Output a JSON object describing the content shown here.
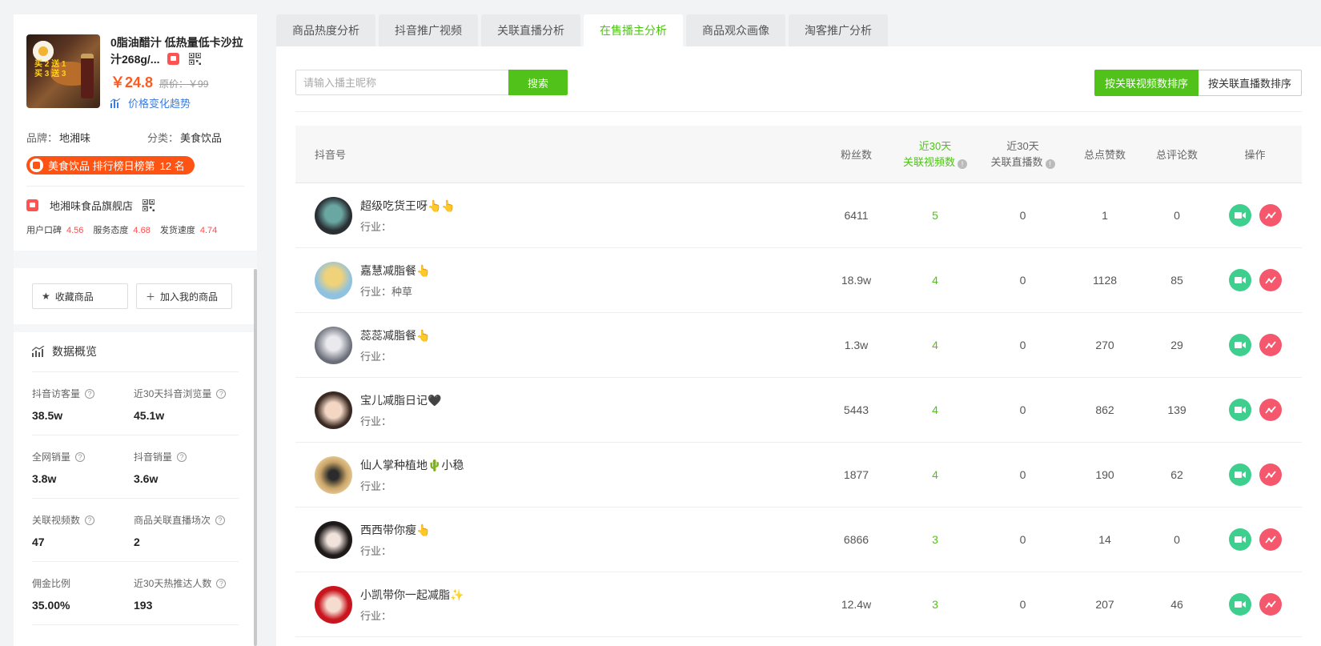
{
  "product": {
    "title": "0脂油醋汁 低热量低卡沙拉汁268g/...",
    "thumb_promo": "买 2 送 1 买 3 送 3",
    "price": "￥24.8",
    "original_price": "原价：￥99",
    "trend_link": "价格变化趋势",
    "brand_label": "品牌：",
    "brand": "地湘味",
    "category_label": "分类：",
    "category": "美食饮品",
    "rank_text": "美食饮品 排行榜日榜第",
    "rank_num": "12 名"
  },
  "shop": {
    "name": "地湘味食品旗舰店",
    "scores": [
      {
        "label": "用户口碑",
        "value": "4.56"
      },
      {
        "label": "服务态度",
        "value": "4.68"
      },
      {
        "label": "发货速度",
        "value": "4.74"
      }
    ]
  },
  "actions": {
    "favorite": "收藏商品",
    "add": "加入我的商品"
  },
  "overview": {
    "title": "数据概览",
    "rows": [
      [
        {
          "label": "抖音访客量",
          "value": "38.5w"
        },
        {
          "label": "近30天抖音浏览量",
          "value": "45.1w"
        }
      ],
      [
        {
          "label": "全网销量",
          "value": "3.8w"
        },
        {
          "label": "抖音销量",
          "value": "3.6w"
        }
      ],
      [
        {
          "label": "关联视频数",
          "value": "47"
        },
        {
          "label": "商品关联直播场次",
          "value": "2"
        }
      ],
      [
        {
          "label": "佣金比例",
          "value": "35.00%"
        },
        {
          "label": "近30天热推达人数",
          "value": "193"
        }
      ]
    ]
  },
  "tabs": [
    "商品热度分析",
    "抖音推广视频",
    "关联直播分析",
    "在售播主分析",
    "商品观众画像",
    "淘客推广分析"
  ],
  "active_tab": "在售播主分析",
  "search": {
    "placeholder": "请输入播主昵称",
    "button": "搜索"
  },
  "sort": {
    "by_video": "按关联视频数排序",
    "by_live": "按关联直播数排序"
  },
  "table": {
    "headers": {
      "account": "抖音号",
      "fans": "粉丝数",
      "videos_l1": "近30天",
      "videos_l2": "关联视频数",
      "live_l1": "近30天",
      "live_l2": "关联直播数",
      "likes": "总点赞数",
      "comments": "总评论数",
      "ops": "操作"
    },
    "industry_label": "行业：",
    "rows": [
      {
        "name": "超级吃货王呀👆👆",
        "industry": "",
        "fans": "6411",
        "videos": "5",
        "lives": "0",
        "likes": "1",
        "comments": "0"
      },
      {
        "name": "嘉慧减脂餐👆",
        "industry": "种草",
        "fans": "18.9w",
        "videos": "4",
        "lives": "0",
        "likes": "1128",
        "comments": "85"
      },
      {
        "name": "蕊蕊减脂餐👆",
        "industry": "",
        "fans": "1.3w",
        "videos": "4",
        "lives": "0",
        "likes": "270",
        "comments": "29"
      },
      {
        "name": "宝儿减脂日记🖤",
        "industry": "",
        "fans": "5443",
        "videos": "4",
        "lives": "0",
        "likes": "862",
        "comments": "139"
      },
      {
        "name": "仙人掌种植地🌵小稳",
        "industry": "",
        "fans": "1877",
        "videos": "4",
        "lives": "0",
        "likes": "190",
        "comments": "62"
      },
      {
        "name": "西西带你瘦👆",
        "industry": "",
        "fans": "6866",
        "videos": "3",
        "lives": "0",
        "likes": "14",
        "comments": "0"
      },
      {
        "name": "小凯带你一起减脂✨",
        "industry": "",
        "fans": "12.4w",
        "videos": "3",
        "lives": "0",
        "likes": "207",
        "comments": "46"
      }
    ]
  },
  "colors": {
    "accent": "#50c21a",
    "price": "#ff5a1e",
    "rank": "#ff5313",
    "video_btn": "#3ecf8e",
    "trend_btn": "#f5576c"
  }
}
